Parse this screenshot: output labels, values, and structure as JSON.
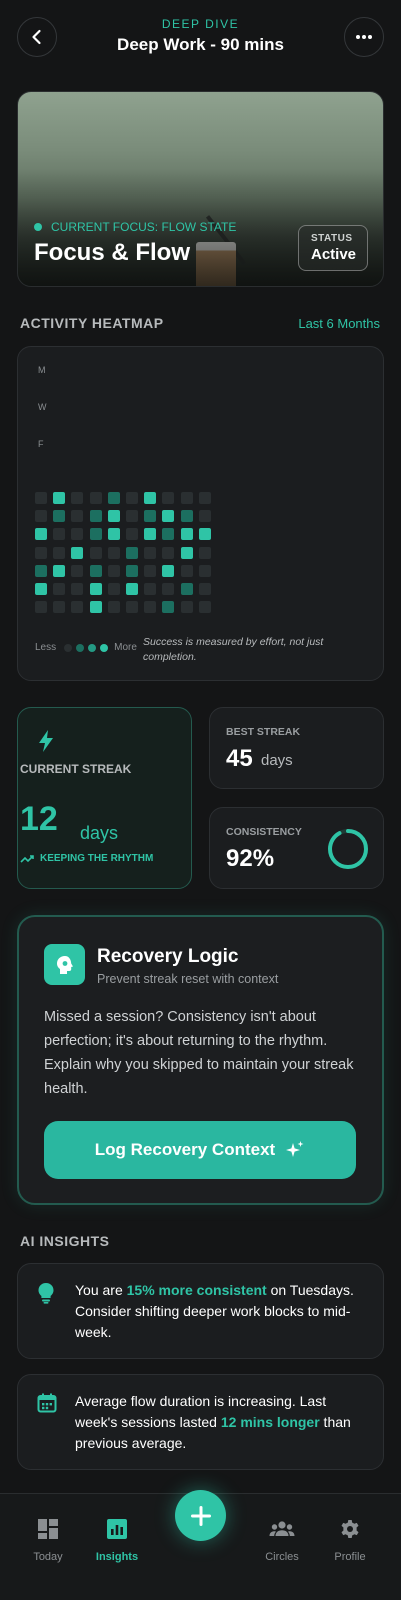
{
  "header": {
    "subtitle": "DEEP DIVE",
    "title": "Deep Work - 90 mins"
  },
  "hero": {
    "focus_label": "CURRENT FOCUS: FLOW STATE",
    "title": "Focus & Flow",
    "status_label": "STATUS",
    "status_value": "Active"
  },
  "heatmap": {
    "section_title": "ACTIVITY HEATMAP",
    "range_link": "Last 6 Months",
    "day_labels": [
      "M",
      "W",
      "F"
    ],
    "levels": [
      [
        0,
        2,
        0,
        0,
        1,
        0,
        2,
        0,
        0,
        0
      ],
      [
        0,
        1,
        0,
        1,
        2,
        0,
        1,
        2,
        1,
        0
      ],
      [
        2,
        0,
        0,
        1,
        2,
        0,
        2,
        1,
        2,
        2
      ],
      [
        0,
        0,
        2,
        0,
        0,
        1,
        0,
        0,
        2,
        0
      ],
      [
        1,
        2,
        0,
        1,
        0,
        1,
        0,
        2,
        0,
        0
      ],
      [
        2,
        0,
        0,
        2,
        0,
        2,
        0,
        0,
        1,
        0
      ],
      [
        0,
        0,
        0,
        2,
        0,
        0,
        0,
        1,
        0,
        0
      ]
    ],
    "legend_less": "Less",
    "legend_more": "More",
    "note": "Success is measured by effort, not just completion."
  },
  "streak": {
    "current_label": "CURRENT STREAK",
    "current_value": "12",
    "current_unit": "days",
    "current_trend": "KEEPING THE RHYTHM",
    "best_label": "BEST STREAK",
    "best_value": "45",
    "best_unit": "days",
    "consistency_label": "CONSISTENCY",
    "consistency_value": "92%",
    "consistency_fraction": 0.92
  },
  "recovery": {
    "title": "Recovery Logic",
    "subtitle": "Prevent streak reset with context",
    "body": "Missed a session? Consistency isn't about perfection; it's about returning to the rhythm. Explain why you skipped to maintain your streak health.",
    "button_label": "Log Recovery Context"
  },
  "insights": {
    "section_title": "AI INSIGHTS",
    "items": [
      {
        "pre": "You are ",
        "highlight": "15% more consistent",
        "post": " on Tuesdays. Consider shifting deeper work blocks to mid-week.",
        "icon": "lightbulb-icon"
      },
      {
        "pre": "Average flow duration is increasing. Last week's sessions lasted ",
        "highlight": "12 mins longer",
        "post": " than previous average.",
        "icon": "calendar-icon"
      }
    ]
  },
  "nav": {
    "items": [
      {
        "label": "Today",
        "icon": "dashboard-icon"
      },
      {
        "label": "Insights",
        "icon": "chart-icon"
      },
      {
        "label": "Circles",
        "icon": "group-icon"
      },
      {
        "label": "Profile",
        "icon": "gear-icon"
      }
    ],
    "active": "Insights"
  },
  "colors": {
    "accent": "#2fc4a6",
    "background": "#141516",
    "card": "#1b1d1f"
  }
}
